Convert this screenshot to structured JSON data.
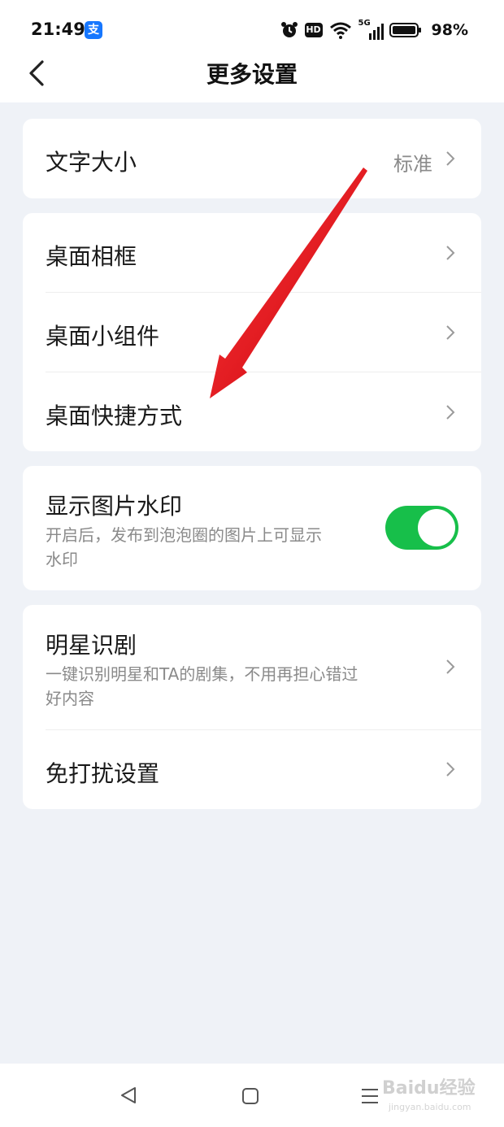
{
  "status": {
    "time": "21:49",
    "app_badge": "支",
    "hd_label": "HD",
    "signal_label": "5G",
    "battery": "98%"
  },
  "header": {
    "title": "更多设置"
  },
  "sections": {
    "font_size": {
      "label": "文字大小",
      "value": "标准"
    },
    "desktop_frame": {
      "label": "桌面相框"
    },
    "desktop_widget": {
      "label": "桌面小组件"
    },
    "desktop_shortcut": {
      "label": "桌面快捷方式"
    },
    "watermark": {
      "label": "显示图片水印",
      "desc_line1": "开启后，发布到泡泡圈的图片上可显示",
      "desc_line2": "水印",
      "enabled": true
    },
    "star_recognition": {
      "label": "明星识剧",
      "desc_line1": "一键识别明星和TA的剧集，不用再担心错过",
      "desc_line2": "好内容"
    },
    "do_not_disturb": {
      "label": "免打扰设置"
    }
  },
  "watermark_overlay": {
    "brand": "Baidu经验",
    "url": "jingyan.baidu.com"
  },
  "colors": {
    "background": "#eff2f7",
    "toggle_on": "#17bf4a",
    "annotation_arrow": "#e0131b"
  }
}
